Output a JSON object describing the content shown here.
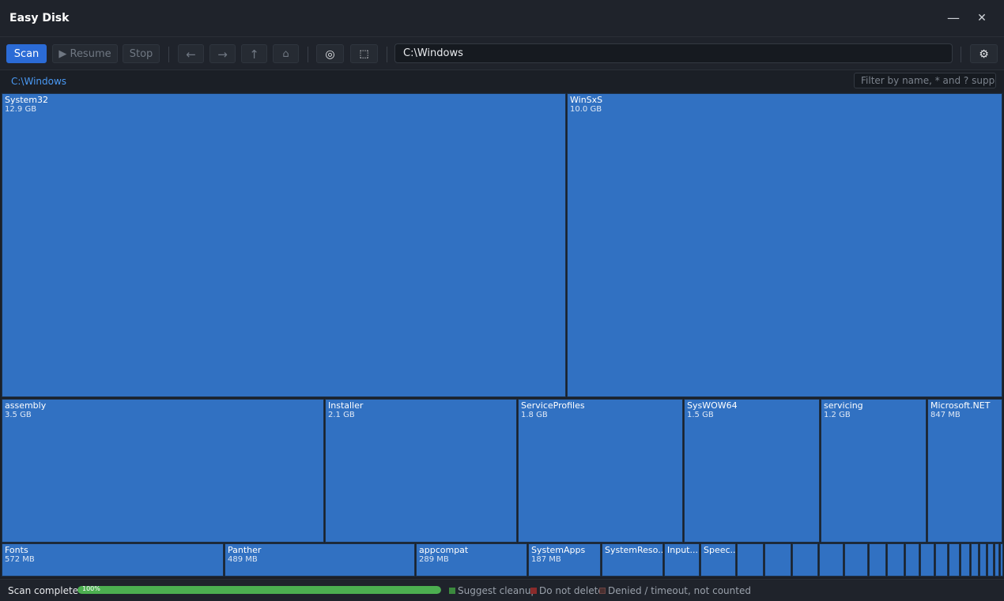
{
  "app": {
    "title": "Easy Disk"
  },
  "window": {
    "minimize_glyph": "—",
    "close_glyph": "✕"
  },
  "toolbar": {
    "scan_label": "Scan",
    "resume_label": "▶ Resume",
    "stop_label": "Stop",
    "back_glyph": "←",
    "forward_glyph": "→",
    "up_glyph": "↑",
    "home_glyph": "⌂",
    "target_glyph": "◎",
    "select_glyph": "⬚",
    "settings_glyph": "⚙",
    "path_value": "C:\\Windows"
  },
  "breadcrumb": "C:\\Windows",
  "filter": {
    "placeholder": "Filter by name, * and ? suppor"
  },
  "treemap": {
    "tile_color": "#3171c2",
    "tiles": [
      {
        "name": "System32",
        "size": "12.9 GB"
      },
      {
        "name": "WinSxS",
        "size": "10.0 GB"
      },
      {
        "name": "assembly",
        "size": "3.5 GB"
      },
      {
        "name": "Installer",
        "size": "2.1 GB"
      },
      {
        "name": "ServiceProfiles",
        "size": "1.8 GB"
      },
      {
        "name": "SysWOW64",
        "size": "1.5 GB"
      },
      {
        "name": "servicing",
        "size": "1.2 GB"
      },
      {
        "name": "Microsoft.NET",
        "size": "847 MB"
      },
      {
        "name": "Fonts",
        "size": "572 MB"
      },
      {
        "name": "Panther",
        "size": "489 MB"
      },
      {
        "name": "appcompat",
        "size": "289 MB"
      },
      {
        "name": "SystemApps",
        "size": "187 MB"
      },
      {
        "name": "SystemReso...",
        "size": ""
      },
      {
        "name": "Input...",
        "size": ""
      },
      {
        "name": "Speec...",
        "size": ""
      },
      {
        "name": "",
        "size": ""
      },
      {
        "name": "",
        "size": ""
      },
      {
        "name": "",
        "size": ""
      },
      {
        "name": "",
        "size": ""
      },
      {
        "name": "",
        "size": ""
      },
      {
        "name": "",
        "size": ""
      },
      {
        "name": "",
        "size": ""
      },
      {
        "name": "",
        "size": ""
      },
      {
        "name": "",
        "size": ""
      },
      {
        "name": "",
        "size": ""
      },
      {
        "name": "",
        "size": ""
      },
      {
        "name": "",
        "size": ""
      },
      {
        "name": "",
        "size": ""
      },
      {
        "name": "",
        "size": ""
      },
      {
        "name": "",
        "size": ""
      }
    ]
  },
  "status": {
    "text": "Scan complete",
    "progress_label": "100%",
    "progress_fraction": 1.0,
    "legend": [
      {
        "label": "Suggest cleanup",
        "color": "#3b8a3e"
      },
      {
        "label": "Do not delete",
        "color": "#8a2b2b"
      },
      {
        "label": "Denied / timeout, not counted",
        "color": "#4a3030"
      }
    ]
  }
}
